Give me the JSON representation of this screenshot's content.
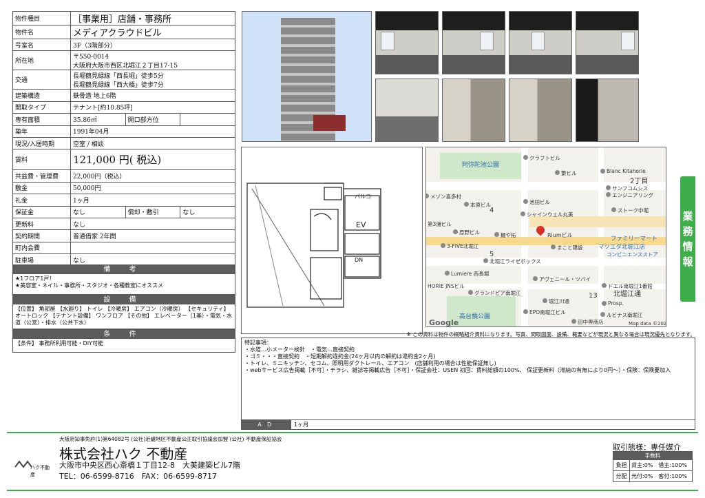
{
  "spec": [
    {
      "k": "物件種目",
      "v": "［事業用］店舗・事務所",
      "big": true
    },
    {
      "k": "物件名",
      "v": "メディアクラウドビル",
      "big": true
    },
    {
      "k": "号室名",
      "v": "3F（3階部分）"
    },
    {
      "k": "所在地",
      "v": "〒550-0014",
      "v2": "大阪府大阪市西区北堀江２丁目17-15",
      "tall": true
    },
    {
      "k": "交通",
      "v": "長堀鶴見緑線「西長堀」徒歩5分",
      "v2": "長堀鶴見緑線「西大橋」徒歩7分",
      "tall": true
    },
    {
      "k": "建築構造",
      "v": "鉄骨造 地上6階"
    },
    {
      "k": "間取タイプ",
      "v": "テナント[約10.85坪]"
    },
    {
      "k": "専有面積",
      "v": "35.86㎡",
      "k2": "開口部方位",
      "v3": ""
    },
    {
      "k": "築年",
      "v": "1991年04月"
    },
    {
      "k": "現況/入居時期",
      "v": "空室 / 相談"
    },
    {
      "k": "賃料",
      "v": "121,000 円( 税込)",
      "rent": true
    },
    {
      "k": "共益費・管理費",
      "v": "22,000円（税込）"
    },
    {
      "k": "敷金",
      "v": "50,000円"
    },
    {
      "k": "礼金",
      "v": "1ヶ月"
    },
    {
      "k": "保証金",
      "v": "なし",
      "k2": "償却・敷引",
      "v3": "なし"
    },
    {
      "k": "更新料",
      "v": "なし"
    },
    {
      "k": "契約期間",
      "v": "普通借家 2年間"
    },
    {
      "k": "町内会費",
      "v": ""
    },
    {
      "k": "駐車場",
      "v": "なし"
    }
  ],
  "remarks": {
    "title": "備 考",
    "lines": [
      "★1フロア1戸！",
      "★美容室・ネイル・事務所・スタジオ・各種教室にオススメ"
    ]
  },
  "facilities": {
    "title": "設 備",
    "text": "【位置】 角部屋 【水廻り】 トイレ 【冷暖房】 エアコン（冷暖房） 【セキュリティ】 オートロック 【テナント設備】 ワンフロア 【その他】 エレベーター（1基）・電気・水道（公営）・排水（公共下水）"
  },
  "conditions": {
    "title": "条 件",
    "text": "【条件】 事務所利用可能・DIY可能"
  },
  "side_tab": [
    "業",
    "務",
    "情",
    "報"
  ],
  "map": {
    "park": "阿弥陀池公園",
    "park2": "高台橋公園",
    "area": "北堀江通",
    "chome": "2丁目",
    "num4": "4",
    "num5": "5",
    "num13": "13",
    "google": "Google",
    "copyright": "Map data ©2023",
    "target": "Riumビル",
    "famima": "ファミリーマート",
    "famima2": "マツエダ北堀江店",
    "famima3": "コンビニエンスストア",
    "labels": [
      "クラフトビル",
      "繁ビル",
      "Blanc Kitahorie",
      "サンフコムシス",
      "エンジニアリング",
      "ストーク中堀",
      "メゾン喜多村",
      "本原ビル",
      "池田ビル",
      "シャインウェル丸美",
      "第3浦ビル",
      "原野ビル",
      "麺や拓",
      "まこと建設",
      "3-FIVE北堀江",
      "北堀江ライゼボックス",
      "Lumiere 西長堀",
      "アヴェニール・ツバイ",
      "ドエル南堀江1番館",
      "HORIE JNSビル",
      "グランドピア南堀江",
      "Prosp.",
      "堀江川通",
      "EPO南堀江ビル",
      "ルビナス南堀江",
      "田中専商店"
    ]
  },
  "plan": {
    "balcony": "バルコ",
    "ev": "EV",
    "dn": "DN"
  },
  "notice": "※ この資料は物件の概略紹介資料になります。写真、間取図面、設備、概要などが現況と異なる場合は現況優先となります。",
  "special": {
    "title": "特記事項：",
    "lines": [
      "・水道…小メーター検針　・電気…直接契約",
      "・ゴミ・・・直接契約　・短期解約違約金(24ヶ月以内の解約は違約金2ヶ月)",
      "・トイレ、ミニキッチン、セコム、照明用ダクトレール、エアコン　(店舗利用の場合は性能保証無し)",
      "・webサービス広告掲載［不可］・チラシ、雑誌等掲載広告［不可］・保証会社：USEN 初回：賃料総額の100%、 保証更新料（滞納の有無により0円〜）・保険：保険要加入"
    ]
  },
  "ad": {
    "label": "ＡＤ",
    "value": "1ヶ月"
  },
  "footer": {
    "license": "大阪府知事免許(1)第64082号 (公社)近畿地区不動産公正取引協議会加盟 (公社) 不動産保証協会",
    "logo_text": "ハク不動産",
    "company": "株式会社ハク 不動産",
    "address": "大阪市中央区西心斎橋１丁目12-8　大美建築ビル7階",
    "tel": "TEL：06-6599-8716　FAX：06-6599-8717"
  },
  "fee": {
    "title": "取引態様：専任媒介",
    "header": "手数料",
    "rows": [
      {
        "k": "負担",
        "v": "貸主:0%　借主:100%"
      },
      {
        "k": "分配",
        "v": "元付:0%　客付:100%"
      }
    ]
  }
}
